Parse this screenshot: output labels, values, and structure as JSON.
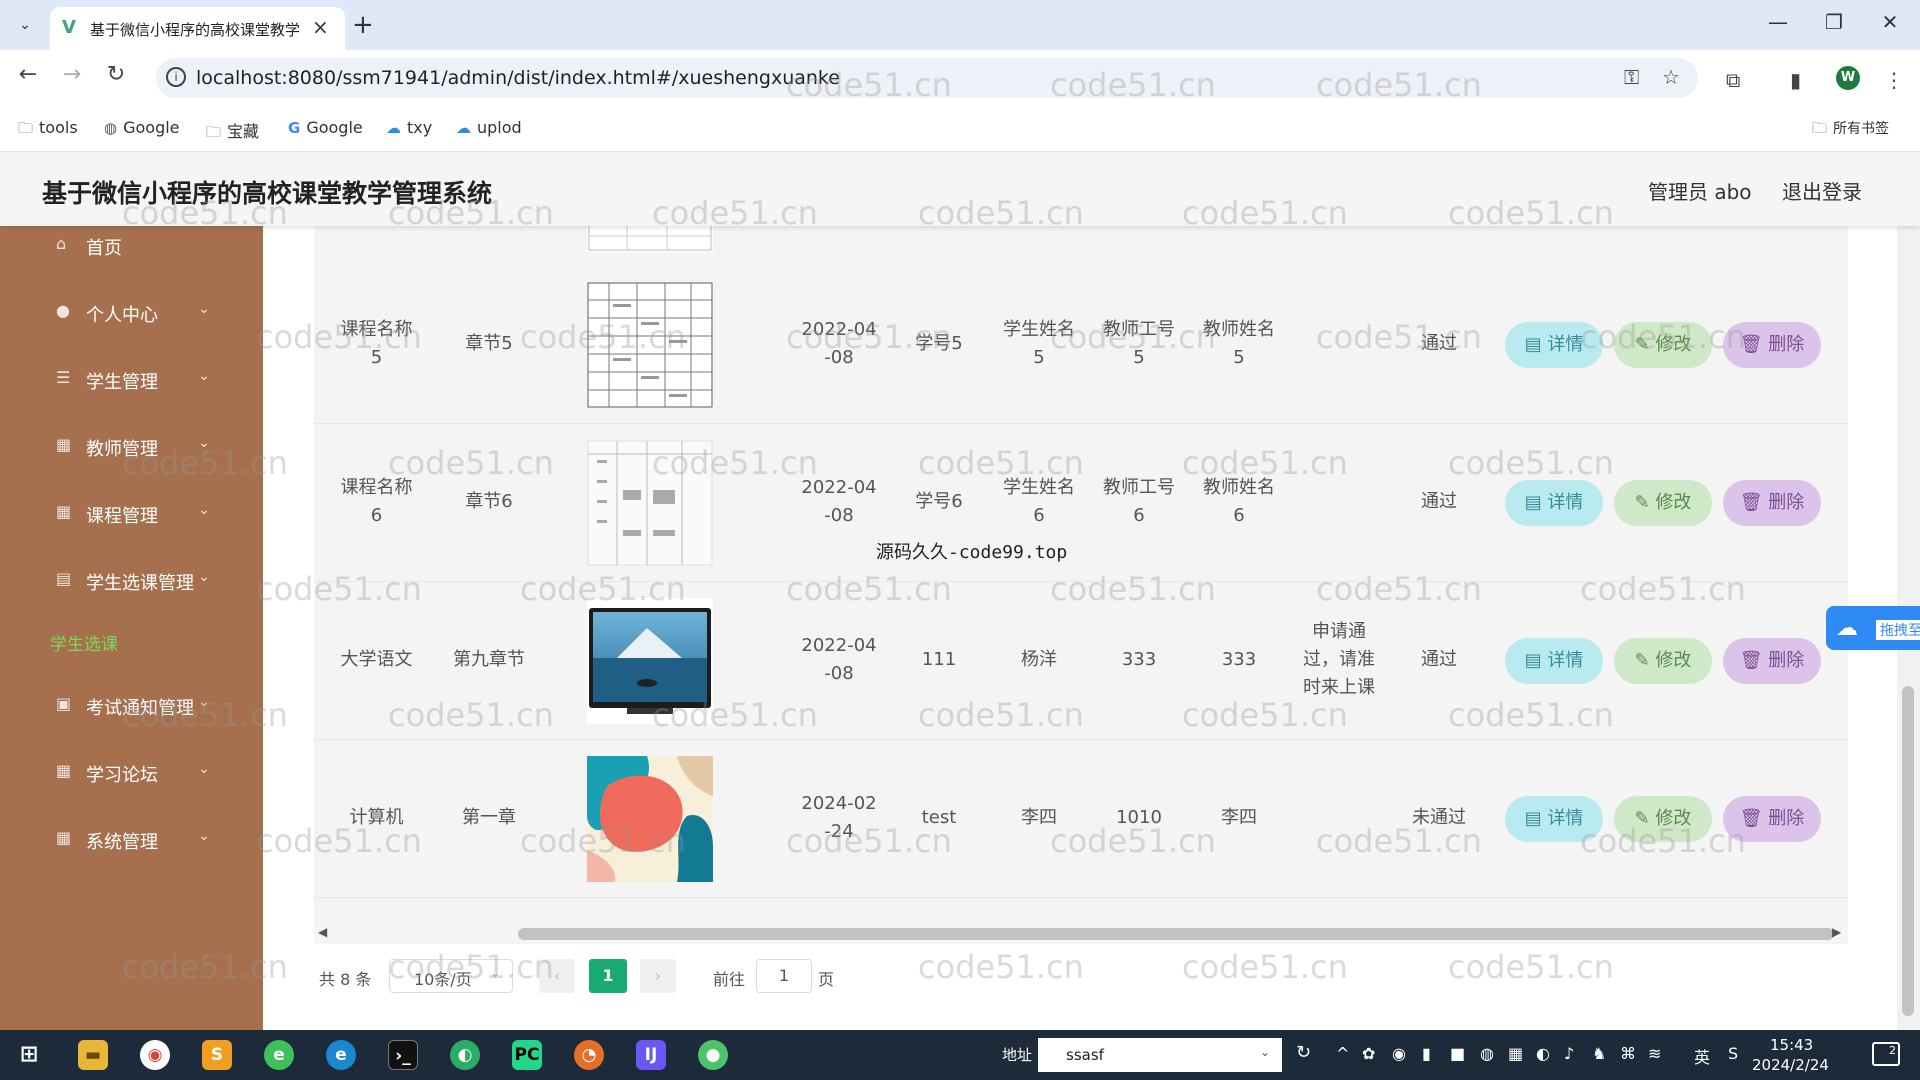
{
  "browser": {
    "tab_title": "基于微信小程序的高校课堂教学",
    "url": "localhost:8080/ssm71941/admin/dist/index.html#/xueshengxuanke",
    "profile_initial": "W",
    "bookmarks": [
      {
        "label": "tools",
        "icon": "folder-icon"
      },
      {
        "label": "Google",
        "icon": "globe-icon"
      },
      {
        "label": "宝藏",
        "icon": "folder-icon"
      },
      {
        "label": "Google",
        "icon": "google-icon"
      },
      {
        "label": "txy",
        "icon": "cloud-icon"
      },
      {
        "label": "uplod",
        "icon": "cloud-icon"
      }
    ],
    "all_bookmarks": "所有书签"
  },
  "header": {
    "title": "基于微信小程序的高校课堂教学管理系统",
    "admin_label": "管理员 abo",
    "logout": "退出登录"
  },
  "sidebar": {
    "items": [
      {
        "label": "首页",
        "icon": "home-icon",
        "chevron": false
      },
      {
        "label": "个人中心",
        "icon": "user-icon",
        "chevron": true
      },
      {
        "label": "学生管理",
        "icon": "list-icon",
        "chevron": true
      },
      {
        "label": "教师管理",
        "icon": "grid-icon",
        "chevron": true
      },
      {
        "label": "课程管理",
        "icon": "grid-icon",
        "chevron": true
      },
      {
        "label": "学生选课管理",
        "icon": "chart-icon",
        "chevron": true
      },
      {
        "label": "考试通知管理",
        "icon": "bell-icon",
        "chevron": true
      },
      {
        "label": "学习论坛",
        "icon": "grid-icon",
        "chevron": true
      },
      {
        "label": "系统管理",
        "icon": "grid-icon",
        "chevron": true
      }
    ],
    "active_sub": "学生选课"
  },
  "table": {
    "buttons": {
      "detail": "详情",
      "edit": "修改",
      "delete": "删除"
    },
    "rows": [
      {
        "course": "课程名称\n5",
        "chapter": "章节5",
        "thumb": "schedule",
        "date": "2022-04\n-08",
        "student_no": "学号5",
        "student_name": "学生姓名\n5",
        "teacher_no": "教师工号\n5",
        "teacher_name": "教师姓名\n5",
        "reply": "",
        "status": "通过"
      },
      {
        "course": "课程名称\n6",
        "chapter": "章节6",
        "thumb": "schedule-faded",
        "date": "2022-04\n-08",
        "student_no": "学号6",
        "student_name": "学生姓名\n6",
        "teacher_no": "教师工号\n6",
        "teacher_name": "教师姓名\n6",
        "reply": "",
        "status": "通过"
      },
      {
        "course": "大学语文",
        "chapter": "第九章节",
        "thumb": "tv-landscape",
        "date": "2022-04\n-08",
        "student_no": "111",
        "student_name": "杨洋",
        "teacher_no": "333",
        "teacher_name": "333",
        "reply": "申请通\n过，请准\n时来上课",
        "status": "通过"
      },
      {
        "course": "计算机",
        "chapter": "第一章",
        "thumb": "abstract-art",
        "date": "2024-02\n-24",
        "student_no": "test",
        "student_name": "李四",
        "teacher_no": "1010",
        "teacher_name": "李四",
        "reply": "",
        "status": "未通过"
      }
    ]
  },
  "pagination": {
    "total": "共 8 条",
    "page_size": "10条/页",
    "current": "1",
    "goto_label": "前往",
    "goto_value": "1",
    "page_unit": "页"
  },
  "watermark": {
    "text": "code51.cn",
    "center_text": "源码久久-code99.top"
  },
  "floating_badge": "拖拽至",
  "taskbar": {
    "addr_label": "地址",
    "addr_value": "ssasf",
    "ime": "英",
    "time": "15:43",
    "date": "2024/2/24",
    "notif_count": "2"
  },
  "colors": {
    "sidebar_bg": "#a6704f",
    "active_sub": "#7ed957",
    "page_active": "#19a974",
    "btn_detail": "#b8eaf0",
    "btn_edit": "#cfe8c8",
    "btn_delete": "#dcc3ea"
  }
}
